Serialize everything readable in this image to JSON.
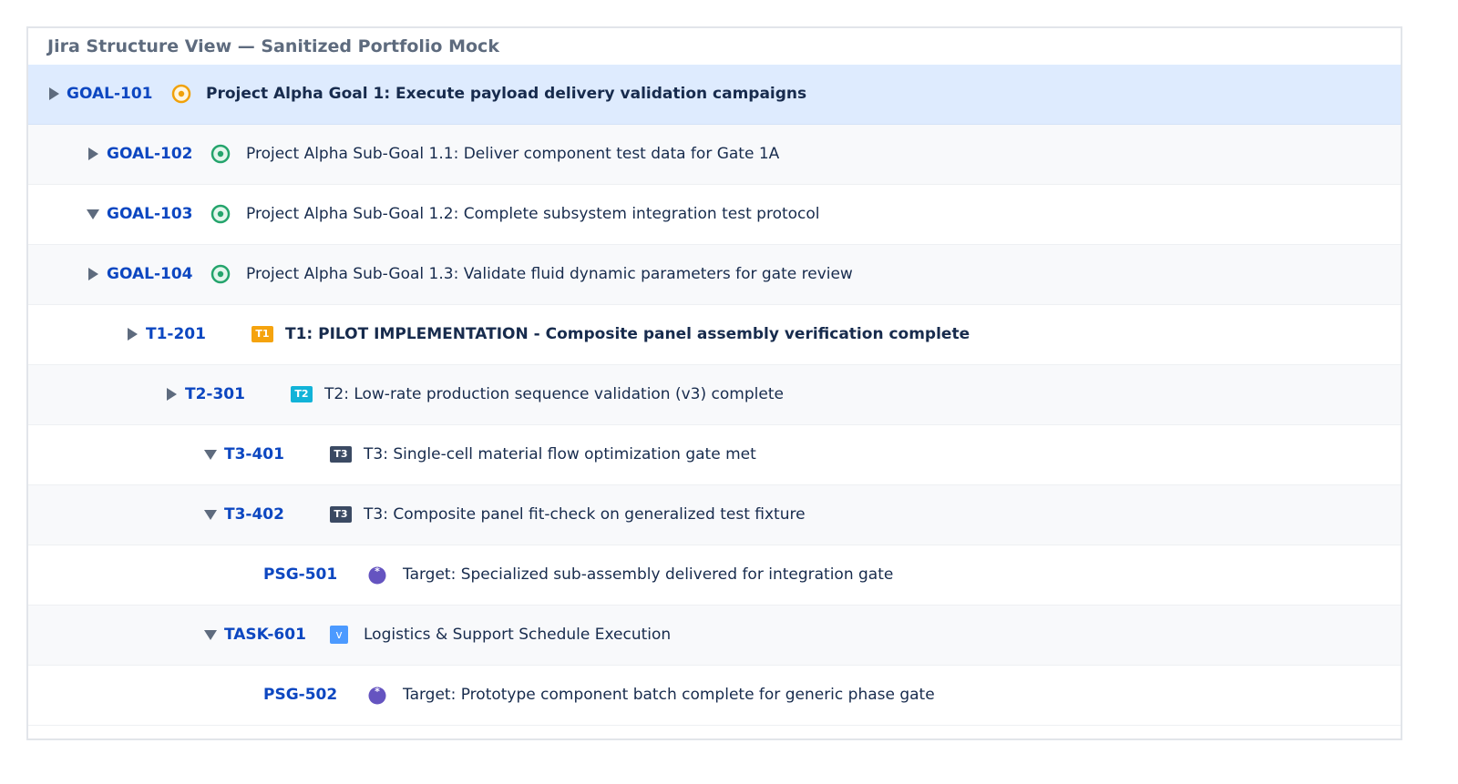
{
  "title": "Jira Structure View — Sanitized Portfolio Mock",
  "colors": {
    "key": "#0d47c1",
    "selected_row": "#deebfe",
    "goal_orange": "#f0a10a",
    "goal_green": "#24a46c",
    "badge_t1": "#f5a30e",
    "badge_t2": "#12b3d8",
    "badge_t3": "#3b4a63",
    "task_blue": "#4c9aff",
    "target_purple": "#6554c0"
  },
  "rows": [
    {
      "key": "GOAL-101",
      "toggle": "collapsed",
      "icon": "goal-orange-icon",
      "summary": "Project Alpha Goal 1: Execute payload delivery validation campaigns",
      "bold": true,
      "selected": true
    },
    {
      "key": "GOAL-102",
      "toggle": "collapsed",
      "icon": "goal-green-icon",
      "summary": "Project Alpha Sub-Goal 1.1: Deliver component test data for Gate 1A",
      "bold": false
    },
    {
      "key": "GOAL-103",
      "toggle": "expanded",
      "icon": "goal-green-icon",
      "summary": "Project Alpha Sub-Goal 1.2: Complete subsystem integration test protocol",
      "bold": false
    },
    {
      "key": "GOAL-104",
      "toggle": "collapsed",
      "icon": "goal-green-icon",
      "summary": "Project Alpha Sub-Goal 1.3: Validate fluid dynamic parameters for gate review",
      "bold": false
    },
    {
      "key": "T1-201",
      "toggle": "collapsed",
      "icon": "t1-badge-icon",
      "badge": "T1",
      "summary": "T1: PILOT IMPLEMENTATION - Composite panel assembly verification complete",
      "bold": true
    },
    {
      "key": "T2-301",
      "toggle": "collapsed",
      "icon": "t2-badge-icon",
      "badge": "T2",
      "summary": "T2: Low-rate production sequence validation (v3) complete",
      "bold": false
    },
    {
      "key": "T3-401",
      "toggle": "expanded",
      "icon": "t3-badge-icon",
      "badge": "T3",
      "summary": "T3: Single-cell material flow optimization gate met",
      "bold": false
    },
    {
      "key": "T3-402",
      "toggle": "expanded",
      "icon": "t3-badge-icon",
      "badge": "T3",
      "summary": "T3: Composite panel fit-check on generalized test fixture",
      "bold": false
    },
    {
      "key": "PSG-501",
      "toggle": "none",
      "icon": "target-icon",
      "summary": "Target: Specialized sub-assembly delivered for integration gate",
      "bold": false
    },
    {
      "key": "TASK-601",
      "toggle": "expanded",
      "icon": "task-checkbox-icon",
      "badge": "v",
      "summary": "Logistics & Support Schedule Execution",
      "bold": false
    },
    {
      "key": "PSG-502",
      "toggle": "none",
      "icon": "target-icon",
      "summary": "Target: Prototype component batch complete for generic phase gate",
      "bold": false
    }
  ]
}
